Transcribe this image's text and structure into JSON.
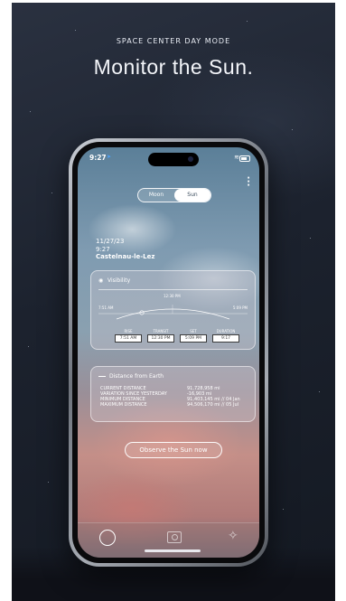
{
  "hero": {
    "subtitle": "SPACE CENTER DAY MODE",
    "title": "Monitor the Sun."
  },
  "status_bar": {
    "time": "9:27"
  },
  "mode_toggle": {
    "options": [
      "Moon",
      "Sun"
    ],
    "selected": "Sun"
  },
  "info": {
    "date": "11/27/23",
    "time": "9:27",
    "place": "Castelnau-le-Lez"
  },
  "visibility": {
    "title": "Visibility",
    "timeline": {
      "start": "7:51 AM",
      "peak": "12:30 PM",
      "end": "5:09 PM"
    },
    "columns": [
      {
        "label": "RISE",
        "value": "7:51 AM"
      },
      {
        "label": "TRANSIT",
        "value": "12:30 PM"
      },
      {
        "label": "SET",
        "value": "5:09 PM"
      },
      {
        "label": "DURATION",
        "value": "9:17"
      }
    ]
  },
  "distance": {
    "title": "Distance from Earth",
    "rows": [
      {
        "label": "CURRENT DISTANCE",
        "value": "91,728,958 mi"
      },
      {
        "label": "VARIATION SINCE YESTERDAY",
        "value": "-16,903 mi"
      },
      {
        "label": "MINIMUM DISTANCE",
        "value": "91,403,145 mi // 04 Jan"
      },
      {
        "label": "MAXIMUM DISTANCE",
        "value": "94,506,170 mi // 05 Jul"
      }
    ]
  },
  "cta": {
    "label": "Observe the Sun now"
  },
  "tabs": {
    "items": [
      "sun-tab",
      "camera-tab",
      "star-tab"
    ],
    "selected": "sun-tab"
  },
  "colors": {
    "accent_location": "#4da3ff",
    "card_border": "#ffffff",
    "value_box_bg": "#ffffff"
  }
}
